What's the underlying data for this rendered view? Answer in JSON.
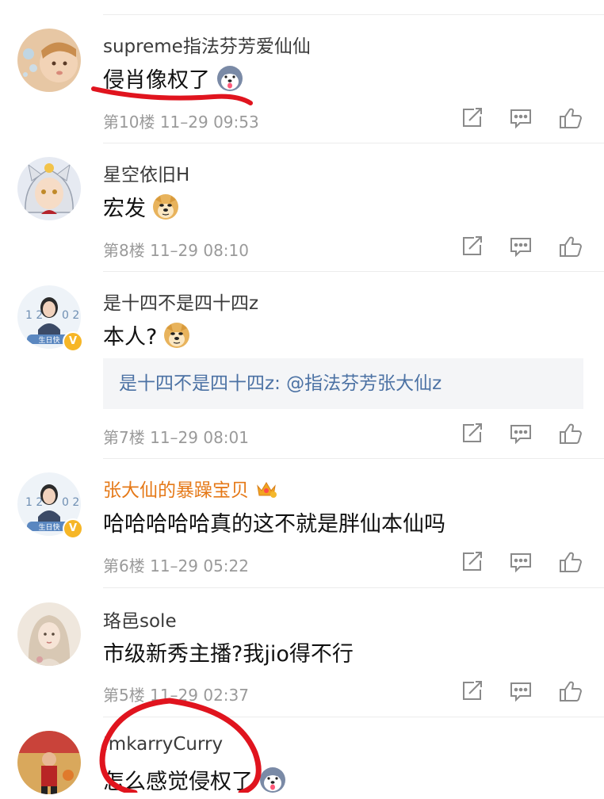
{
  "comments": [
    {
      "username": "supreme指法芬芳爱仙仙",
      "text": "侵肖像权了",
      "floor": "第10楼",
      "time": "11–29 09:53",
      "emoji": "husky-emoji-icon"
    },
    {
      "username": "星空依旧H",
      "text": "宏发",
      "floor": "第8楼",
      "time": "11–29 08:10",
      "emoji": "doge-emoji-icon"
    },
    {
      "username": "是十四不是四十四z",
      "text": "本人?",
      "floor": "第7楼",
      "time": "11–29 08:01",
      "emoji": "doge-emoji-icon",
      "quote": "是十四不是四十四z: @指法芬芳张大仙z"
    },
    {
      "username": "张大仙的暴躁宝贝",
      "text": "哈哈哈哈哈真的这不就是胖仙本仙吗",
      "floor": "第6楼",
      "time": "11–29 05:22"
    },
    {
      "username": "珞邑sole",
      "text": "市级新秀主播?我jio得不行",
      "floor": "第5楼",
      "time": "11–29 02:37"
    },
    {
      "username": "ImkarryCurry",
      "text": "怎么感觉侵权了",
      "emoji": "husky-emoji-icon"
    }
  ],
  "avatar_badges": {
    "verified": "V",
    "birthday": "生日快"
  },
  "colors": {
    "link": "#4c72a4",
    "vip_name": "#e57918",
    "meta": "#9a9a9a",
    "annotation": "#e0141e"
  }
}
